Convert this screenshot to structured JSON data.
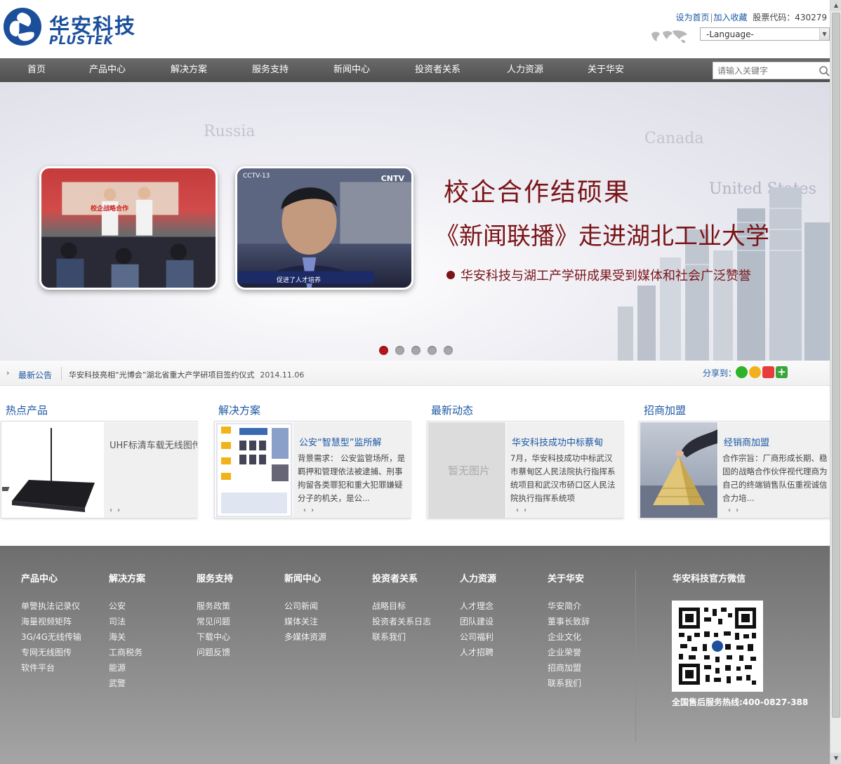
{
  "brand": {
    "name_cn": "华安科技",
    "name_en": "PLUSTEK"
  },
  "top_links": {
    "set_home": "设为首页",
    "add_favorite": "加入收藏",
    "stock_label": "股票代码：430279"
  },
  "language": {
    "selected": "-Language-"
  },
  "nav": {
    "items": [
      {
        "label": "首页"
      },
      {
        "label": "产品中心"
      },
      {
        "label": "解决方案"
      },
      {
        "label": "服务支持"
      },
      {
        "label": "新闻中心"
      },
      {
        "label": "投资者关系"
      },
      {
        "label": "人力资源"
      },
      {
        "label": "关于华安"
      }
    ],
    "search_placeholder": "请输入关键字"
  },
  "banner": {
    "map_labels": [
      "Russia",
      "Canada",
      "United States"
    ],
    "title": "校企合作结硕果",
    "subtitle": "《新闻联播》走进湖北工业大学",
    "bullet": "华安科技与湖工产学研成果受到媒体和社会广泛赞誉",
    "photo1_caption": "校企战略合作",
    "photo2_caption": "促进了人才培养",
    "photo2_channel": "CCTV-13",
    "photo2_logo": "CNTV",
    "slide_count": 5,
    "active_slide": 0
  },
  "notice": {
    "label": "最新公告",
    "text": "华安科技亮相“光博会”湖北省重大产学研项目签约仪式",
    "date": "2014.11.06",
    "share_label": "分享到："
  },
  "sections": [
    {
      "title": "热点产品",
      "heading": "UHF标清车载无线图传",
      "desc": ""
    },
    {
      "title": "解决方案",
      "heading": "公安“智慧型”监所解",
      "desc": "背景需求： 公安监管场所，是羁押和管理依法被逮捕、刑事拘留各类罪犯和重大犯罪嫌疑分子的机关，是公..."
    },
    {
      "title": "最新动态",
      "heading": "华安科技成功中标蔡甸",
      "desc": "7月，华安科技成功中标武汉市蔡甸区人民法院执行指挥系统项目和武汉市硚口区人民法院执行指挥系统项",
      "no_image": "暂无图片"
    },
    {
      "title": "招商加盟",
      "heading": "经销商加盟",
      "desc": "合作宗旨：厂商形成长期、稳固的战略合作伙伴视代理商为自己的终端销售队伍重视诚信合力培..."
    }
  ],
  "pager": "‹ ›",
  "footer": {
    "columns": [
      {
        "title": "产品中心",
        "links": [
          "单警执法记录仪",
          "海量视频矩阵",
          "3G/4G无线传输",
          "专网无线图传",
          "软件平台"
        ]
      },
      {
        "title": "解决方案",
        "links": [
          "公安",
          "司法",
          "海关",
          "工商税务",
          "能源",
          "武警"
        ]
      },
      {
        "title": "服务支持",
        "links": [
          "服务政策",
          "常见问题",
          "下载中心",
          "问题反馈"
        ]
      },
      {
        "title": "新闻中心",
        "links": [
          "公司新闻",
          "媒体关注",
          "多媒体资源"
        ]
      },
      {
        "title": "投资者关系",
        "links": [
          "战略目标",
          "投资者关系日志",
          "联系我们"
        ]
      },
      {
        "title": "人力资源",
        "links": [
          "人才理念",
          "团队建设",
          "公司福利",
          "人才招聘"
        ]
      },
      {
        "title": "关于华安",
        "links": [
          "华安简介",
          "董事长致辞",
          "企业文化",
          "企业荣誉",
          "招商加盟",
          "联系我们"
        ]
      }
    ],
    "wechat_title": "华安科技官方微信",
    "hotline": "全国售后服务热线:400-0827-388"
  },
  "colors": {
    "brand_blue": "#1b4f9c",
    "banner_red": "#7a1417",
    "link_blue": "#1b57a3",
    "nav_gray": "#5a5a5a"
  }
}
